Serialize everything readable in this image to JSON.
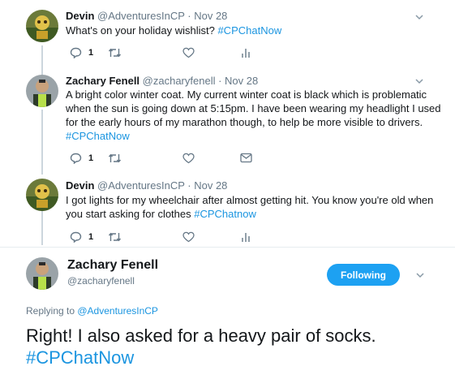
{
  "thread": [
    {
      "name": "Devin",
      "handle": "@AdventuresInCP",
      "date": "Nov 28",
      "text": "What's on your holiday wishlist? ",
      "hashtag": "#CPChatNow",
      "reply_count": "1"
    },
    {
      "name": "Zachary Fenell",
      "handle": "@zacharyfenell",
      "date": "Nov 28",
      "lines": [
        "A bright color winter coat. My current winter coat is black which is problematic",
        "when the sun is going down at 5:15pm. I have been wearing my headlight I used",
        "for the early hours of my marathon though, to help be more visible to drivers."
      ],
      "hashtag": "#CPChatNow",
      "reply_count": "1"
    },
    {
      "name": "Devin",
      "handle": "@AdventuresInCP",
      "date": "Nov 28",
      "lines": [
        "I got lights for my wheelchair after almost getting hit. You know you're old when",
        "you start asking for clothes "
      ],
      "hashtag": "#CPChatnow",
      "reply_count": "1"
    }
  ],
  "main": {
    "name": "Zachary Fenell",
    "handle": "@zacharyfenell",
    "follow_label": "Following",
    "replying_prefix": "Replying to ",
    "replying_handle": "@AdventuresInCP",
    "text": "Right! I also asked for a heavy pair of socks.",
    "hashtag": "#CPChatNow"
  },
  "separator": " · ",
  "colors": {
    "accent": "#1da1f2",
    "link": "#1b95e0",
    "muted": "#657786",
    "thread_line": "#ccd6dd"
  },
  "icons": {
    "reply": "reply-icon",
    "retweet": "retweet-icon",
    "like": "heart-icon",
    "analytics": "analytics-icon",
    "dm": "envelope-icon",
    "caret": "chevron-down-icon"
  }
}
